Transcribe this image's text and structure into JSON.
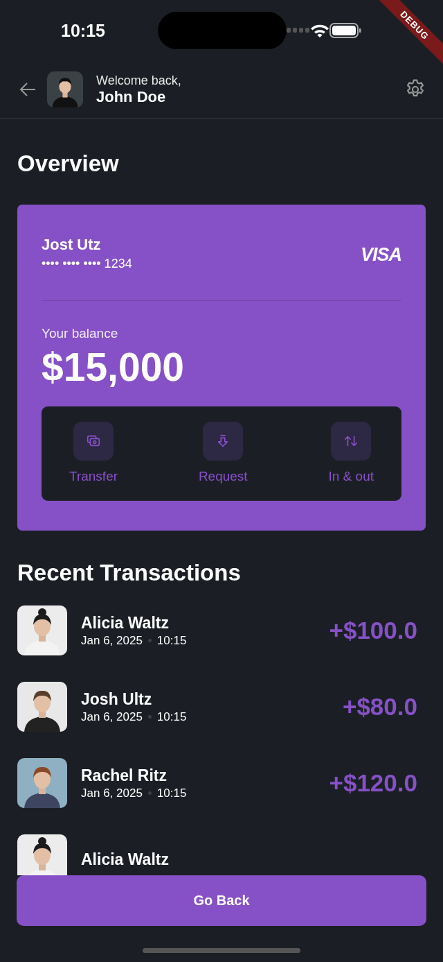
{
  "status_bar": {
    "time": "10:15"
  },
  "debug_banner": "DEBUG",
  "header": {
    "greeting": "Welcome back,",
    "name": "John Doe"
  },
  "title": "Overview",
  "card": {
    "holder": "Jost Utz",
    "masked_number": "•••• •••• •••• 1234",
    "brand": "VISA",
    "balance_label": "Your balance",
    "balance": "$15,000",
    "actions": [
      {
        "kind": "transfer",
        "label": "Transfer"
      },
      {
        "kind": "request",
        "label": "Request"
      },
      {
        "kind": "inout",
        "label": "In & out"
      }
    ]
  },
  "transactions_title": "Recent Transactions",
  "transactions": [
    {
      "name": "Alicia Waltz",
      "date": "Jan 6, 2025",
      "time": "10:15",
      "amount": "+$100.0"
    },
    {
      "name": "Josh Ultz",
      "date": "Jan 6, 2025",
      "time": "10:15",
      "amount": "+$80.0"
    },
    {
      "name": "Rachel Ritz",
      "date": "Jan 6, 2025",
      "time": "10:15",
      "amount": "+$120.0"
    },
    {
      "name": "Alicia Waltz"
    }
  ],
  "go_back": "Go Back"
}
